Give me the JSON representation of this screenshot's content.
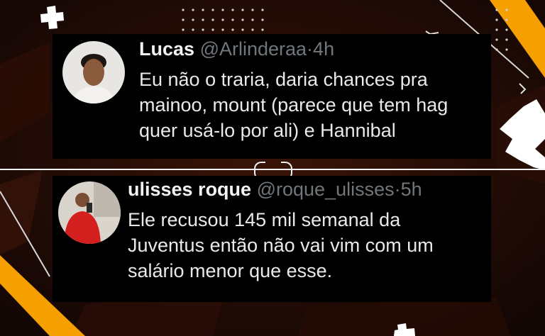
{
  "tweets": [
    {
      "name": "Lucas",
      "handle": "@Arlinderaa",
      "separator": "·",
      "time": "4h",
      "lines": [
        "Eu não o traria, daria chances pra",
        "mainoo, mount (parece que tem hag",
        "quer usá-lo por ali) e Hannibal"
      ]
    },
    {
      "name": "ulisses roque",
      "handle": "@roque_ulisses",
      "separator": "·",
      "time": "5h",
      "lines": [
        "Ele recusou 145 mil semanal da",
        "Juventus então não vai vim com um",
        "salário menor que esse."
      ]
    }
  ],
  "colors": {
    "background": "#1a0a05",
    "card": "#000000",
    "accent": "#f5a000",
    "text": "#e7e9ea",
    "muted": "#71767b"
  }
}
